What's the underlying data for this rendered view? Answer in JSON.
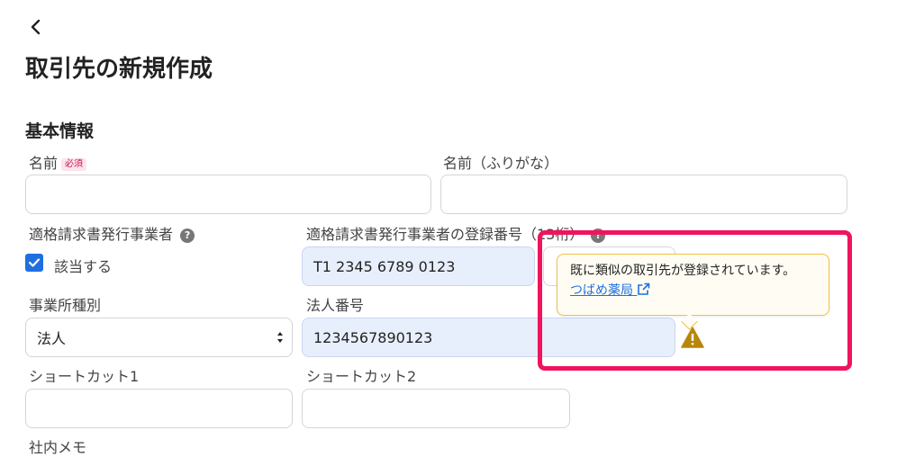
{
  "header": {
    "back_icon": "chevron-left-icon",
    "title": "取引先の新規作成"
  },
  "section_title": "基本情報",
  "fields": {
    "name": {
      "label": "名前",
      "required_badge": "必須",
      "value": ""
    },
    "name_kana": {
      "label": "名前（ふりがな）",
      "value": ""
    },
    "qualified_issuer": {
      "label": "適格請求書発行事業者",
      "checkbox_label": "該当する",
      "checked": true
    },
    "registration_number": {
      "label": "適格請求書発行事業者の登録番号（13桁）",
      "value": "T1 2345 6789 0123"
    },
    "business_type": {
      "label": "事業所種別",
      "selected": "法人"
    },
    "corporate_number": {
      "label": "法人番号",
      "value": "1234567890123"
    },
    "shortcut1": {
      "label": "ショートカット1",
      "value": ""
    },
    "shortcut2": {
      "label": "ショートカット2",
      "value": ""
    },
    "internal_memo": {
      "label": "社内メモ"
    }
  },
  "warning": {
    "message": "既に類似の取引先が登録されています。",
    "link_text": "つばめ薬局",
    "link_icon": "external-link-icon",
    "icon": "warning-triangle-icon"
  },
  "colors": {
    "accent": "#1f6fe0",
    "highlight_border": "#f0145d",
    "warning_icon": "#b8860b",
    "tooltip_border": "#f1c04a"
  }
}
